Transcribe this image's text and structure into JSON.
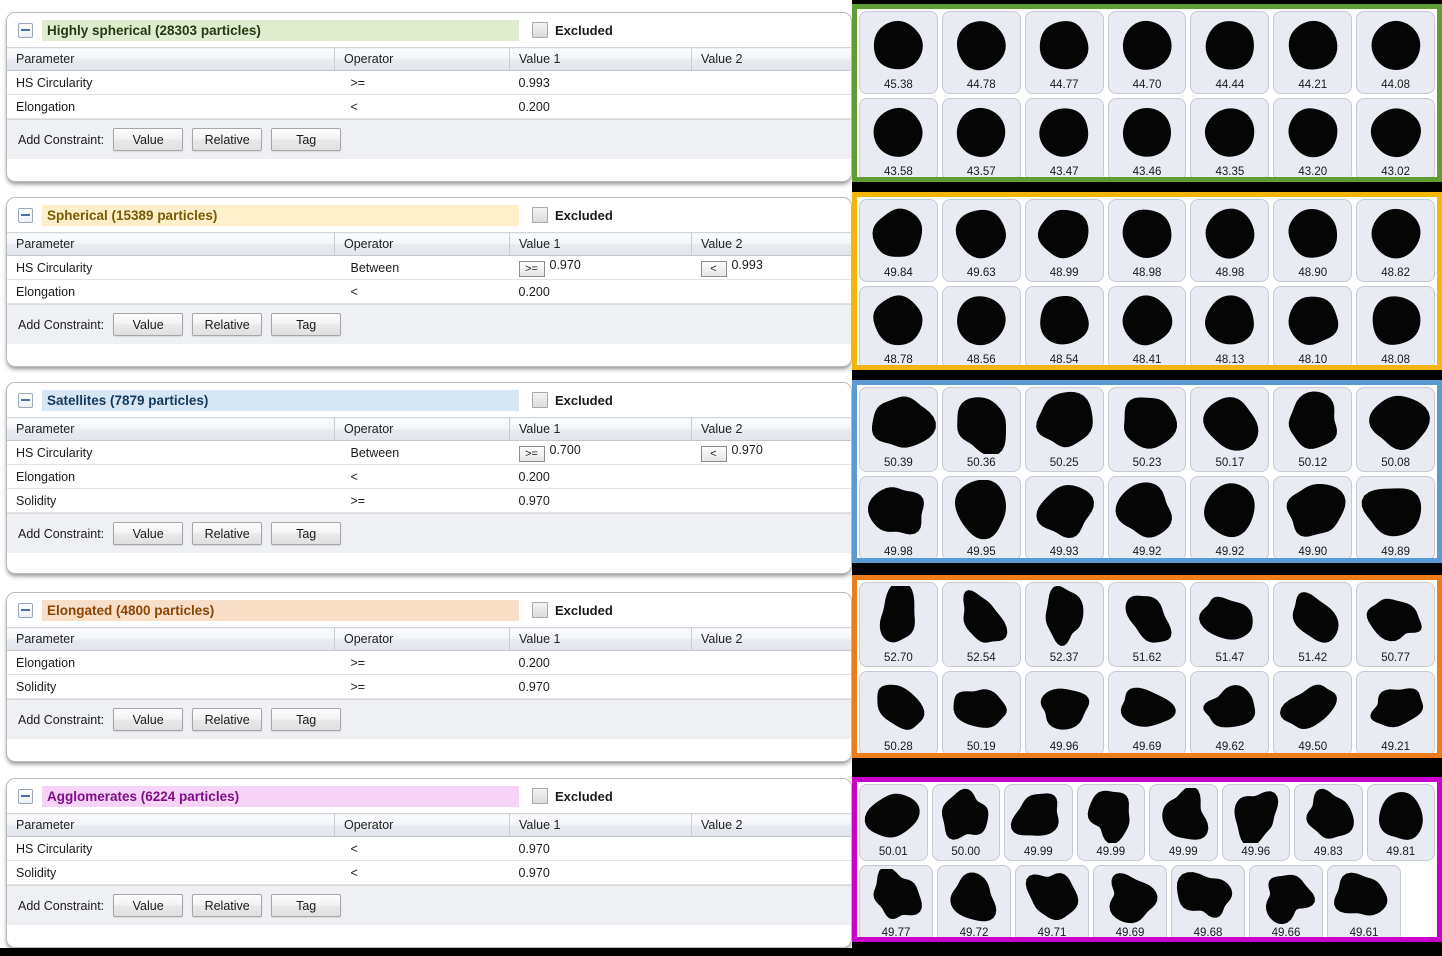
{
  "table": {
    "columns": [
      "Parameter",
      "Operator",
      "Value 1",
      "Value 2"
    ]
  },
  "footer": {
    "add_constraint_label": "Add Constraint:",
    "buttons": [
      "Value",
      "Relative",
      "Tag"
    ]
  },
  "excluded_label": "Excluded",
  "panels": [
    {
      "id": "highly-spherical",
      "title": "Highly spherical (28303 particles)",
      "chip_color": "#dfeccd",
      "title_color": "#243b12",
      "border_color": "#5f9e33",
      "excluded": false,
      "rows": [
        {
          "parameter": "HS Circularity",
          "operator": ">=",
          "value1": "0.993",
          "value1_op": "",
          "value2": "",
          "value2_op": ""
        },
        {
          "parameter": "Elongation",
          "operator": "<",
          "value1": "0.200",
          "value1_op": "",
          "value2": "",
          "value2_op": ""
        }
      ],
      "gallery": {
        "rows": [
          [
            "45.38",
            "44.78",
            "44.77",
            "44.70",
            "44.44",
            "44.21",
            "44.08"
          ],
          [
            "43.58",
            "43.57",
            "43.47",
            "43.46",
            "43.35",
            "43.20",
            "43.02"
          ]
        ]
      }
    },
    {
      "id": "spherical",
      "title": "Spherical (15389 particles)",
      "chip_color": "#fdefc9",
      "title_color": "#7a5a06",
      "border_color": "#f5b50a",
      "excluded": false,
      "rows": [
        {
          "parameter": "HS Circularity",
          "operator": "Between",
          "value1": "0.970",
          "value1_op": ">=",
          "value2": "0.993",
          "value2_op": "<"
        },
        {
          "parameter": "Elongation",
          "operator": "<",
          "value1": "0.200",
          "value1_op": "",
          "value2": "",
          "value2_op": ""
        }
      ],
      "gallery": {
        "rows": [
          [
            "49.84",
            "49.63",
            "48.99",
            "48.98",
            "48.98",
            "48.90",
            "48.82"
          ],
          [
            "48.78",
            "48.56",
            "48.54",
            "48.41",
            "48.13",
            "48.10",
            "48.08"
          ]
        ]
      }
    },
    {
      "id": "satellites",
      "title": "Satellites (7879 particles)",
      "chip_color": "#d6e6f4",
      "title_color": "#123a5e",
      "border_color": "#5b9bd5",
      "excluded": false,
      "rows": [
        {
          "parameter": "HS Circularity",
          "operator": "Between",
          "value1": "0.700",
          "value1_op": ">=",
          "value2": "0.970",
          "value2_op": "<"
        },
        {
          "parameter": "Elongation",
          "operator": "<",
          "value1": "0.200",
          "value1_op": "",
          "value2": "",
          "value2_op": ""
        },
        {
          "parameter": "Solidity",
          "operator": ">=",
          "value1": "0.970",
          "value1_op": "",
          "value2": "",
          "value2_op": ""
        }
      ],
      "gallery": {
        "rows": [
          [
            "50.39",
            "50.36",
            "50.25",
            "50.23",
            "50.17",
            "50.12",
            "50.08"
          ],
          [
            "49.98",
            "49.95",
            "49.93",
            "49.92",
            "49.92",
            "49.90",
            "49.89"
          ]
        ]
      }
    },
    {
      "id": "elongated",
      "title": "Elongated (4800 particles)",
      "chip_color": "#fadfc8",
      "title_color": "#8a4408",
      "border_color": "#ed7d1b",
      "excluded": false,
      "rows": [
        {
          "parameter": "Elongation",
          "operator": ">=",
          "value1": "0.200",
          "value1_op": "",
          "value2": "",
          "value2_op": ""
        },
        {
          "parameter": "Solidity",
          "operator": ">=",
          "value1": "0.970",
          "value1_op": "",
          "value2": "",
          "value2_op": ""
        }
      ],
      "gallery": {
        "rows": [
          [
            "52.70",
            "52.54",
            "52.37",
            "51.62",
            "51.47",
            "51.42",
            "50.77"
          ],
          [
            "50.28",
            "50.19",
            "49.96",
            "49.69",
            "49.62",
            "49.50",
            "49.21"
          ]
        ]
      }
    },
    {
      "id": "agglomerates",
      "title": "Agglomerates (6224 particles)",
      "chip_color": "#f8d3f8",
      "title_color": "#7d0f86",
      "border_color": "#cc00cc",
      "excluded": false,
      "rows": [
        {
          "parameter": "HS Circularity",
          "operator": "<",
          "value1": "0.970",
          "value1_op": "",
          "value2": "",
          "value2_op": ""
        },
        {
          "parameter": "Solidity",
          "operator": "<",
          "value1": "0.970",
          "value1_op": "",
          "value2": "",
          "value2_op": ""
        }
      ],
      "gallery": {
        "rows": [
          [
            "50.01",
            "50.00",
            "49.99",
            "49.99",
            "49.99",
            "49.96",
            "49.83",
            "49.81"
          ],
          [
            "49.77",
            "49.72",
            "49.71",
            "49.69",
            "49.68",
            "49.66",
            "49.61"
          ]
        ]
      }
    }
  ]
}
